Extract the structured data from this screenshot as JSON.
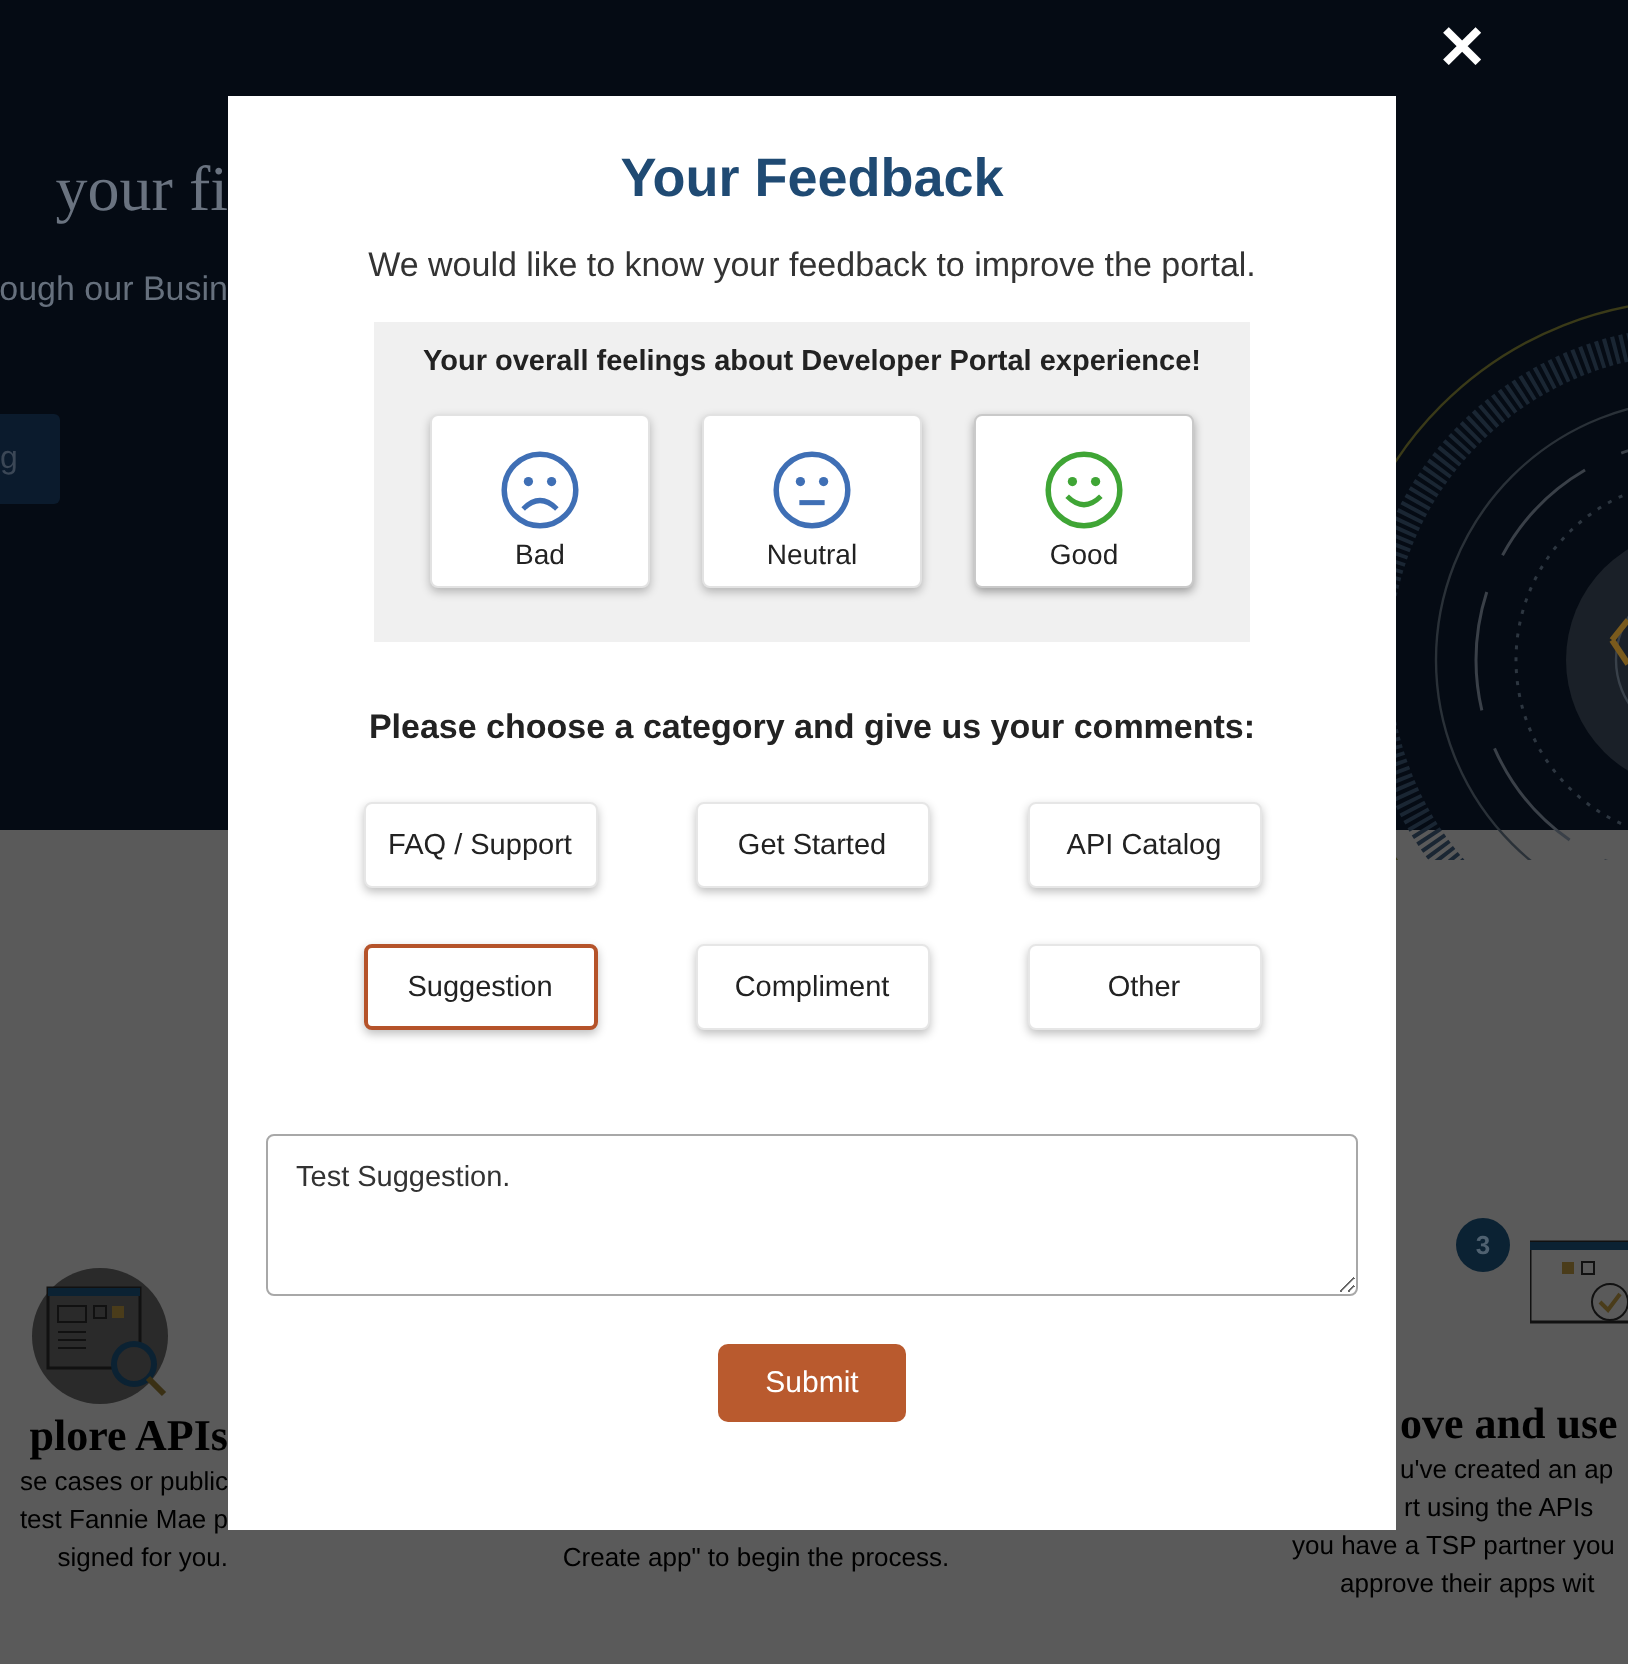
{
  "background": {
    "hero_heading": "your fi",
    "hero_text": "ough our Busin",
    "hero_button": "g",
    "left_card": {
      "title": "plore APIs",
      "lines": [
        "se cases or public",
        "test Fannie Mae p",
        "signed for you."
      ]
    },
    "center_text": "Create app\" to begin the process.",
    "right_card": {
      "step": "3",
      "title": "ove and use",
      "lines": [
        "u've created an ap",
        "rt using the APIs",
        "you have a TSP partner you",
        "approve their apps wit"
      ]
    }
  },
  "close_button": "✕",
  "modal": {
    "title": "Your Feedback",
    "subtitle": "We would like to know your feedback to improve the portal.",
    "feelings": {
      "heading": "Your overall feelings about Developer Portal experience!",
      "options": [
        {
          "label": "Bad",
          "kind": "sad",
          "selected": false
        },
        {
          "label": "Neutral",
          "kind": "neutral",
          "selected": false
        },
        {
          "label": "Good",
          "kind": "happy",
          "selected": true
        }
      ]
    },
    "category_heading": "Please choose a category and give us your comments:",
    "categories": [
      {
        "label": "FAQ / Support",
        "selected": false
      },
      {
        "label": "Get Started",
        "selected": false
      },
      {
        "label": "API Catalog",
        "selected": false
      },
      {
        "label": "Suggestion",
        "selected": true
      },
      {
        "label": "Compliment",
        "selected": false
      },
      {
        "label": "Other",
        "selected": false
      }
    ],
    "comment": "Test Suggestion.",
    "submit": "Submit"
  }
}
